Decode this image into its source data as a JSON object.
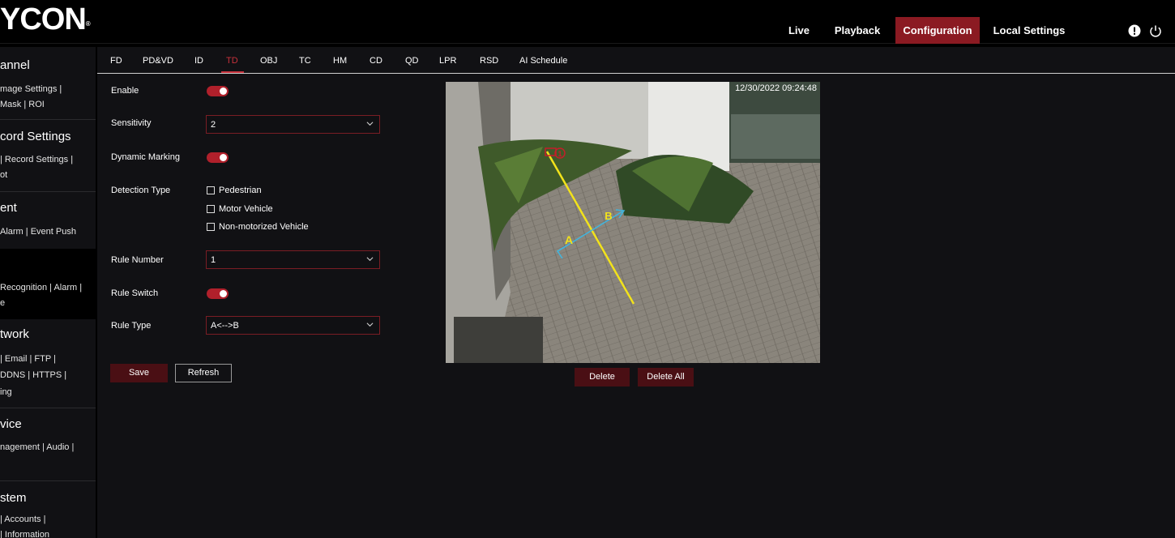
{
  "header": {
    "logo": "YCON",
    "nav": [
      {
        "label": "Live",
        "active": false
      },
      {
        "label": "Playback",
        "active": false
      },
      {
        "label": "Configuration",
        "active": true
      },
      {
        "label": "Local Settings",
        "active": false
      }
    ],
    "icons": [
      "info-icon",
      "power-icon"
    ]
  },
  "sidebar": {
    "sections": [
      {
        "title": "annel",
        "links": [
          "mage Settings |",
          "Mask  |  ROI"
        ]
      },
      {
        "title": "cord Settings",
        "links": [
          "|  Record Settings  |",
          "ot"
        ]
      },
      {
        "title": "ent",
        "links": [
          "Alarm  |  Event Push"
        ]
      },
      {
        "title": "",
        "links": [
          "Recognition  |  Alarm  |",
          "e"
        ]
      },
      {
        "title": "twork",
        "links": [
          "|  Email  |  FTP  |",
          "DDNS  |  HTTPS  |",
          "ing"
        ]
      },
      {
        "title": "vice",
        "links": [
          "nagement  |  Audio  |"
        ]
      },
      {
        "title": "stem",
        "links": [
          "|  Accounts  |",
          "|  Information"
        ]
      }
    ]
  },
  "tabs": [
    {
      "label": "FD",
      "active": false
    },
    {
      "label": "PD&VD",
      "active": false
    },
    {
      "label": "ID",
      "active": false
    },
    {
      "label": "TD",
      "active": true
    },
    {
      "label": "OBJ",
      "active": false
    },
    {
      "label": "TC",
      "active": false
    },
    {
      "label": "HM",
      "active": false
    },
    {
      "label": "CD",
      "active": false
    },
    {
      "label": "QD",
      "active": false
    },
    {
      "label": "LPR",
      "active": false
    },
    {
      "label": "RSD",
      "active": false
    },
    {
      "label": "AI Schedule",
      "active": false
    }
  ],
  "form": {
    "enable_label": "Enable",
    "enable_on": true,
    "sensitivity_label": "Sensitivity",
    "sensitivity_value": "2",
    "dynamic_marking_label": "Dynamic Marking",
    "dynamic_marking_on": true,
    "detection_type_label": "Detection Type",
    "detection_types": [
      {
        "label": "Pedestrian",
        "checked": false
      },
      {
        "label": "Motor Vehicle",
        "checked": false
      },
      {
        "label": "Non-motorized Vehicle",
        "checked": false
      }
    ],
    "rule_number_label": "Rule Number",
    "rule_number_value": "1",
    "rule_switch_label": "Rule Switch",
    "rule_switch_on": true,
    "rule_type_label": "Rule Type",
    "rule_type_value": "A<-->B",
    "save_label": "Save",
    "refresh_label": "Refresh"
  },
  "video": {
    "timestamp": "12/30/2022 09:24:48",
    "rule_marker": "1",
    "marker_a": "A",
    "marker_b": "B",
    "delete_label": "Delete",
    "delete_all_label": "Delete All"
  },
  "colors": {
    "accent": "#8b1a22",
    "toggle": "#b0202b",
    "active_tab": "#c8313b",
    "rule_line": "#f2e21b",
    "direction_arrow": "#3fb6e0"
  }
}
